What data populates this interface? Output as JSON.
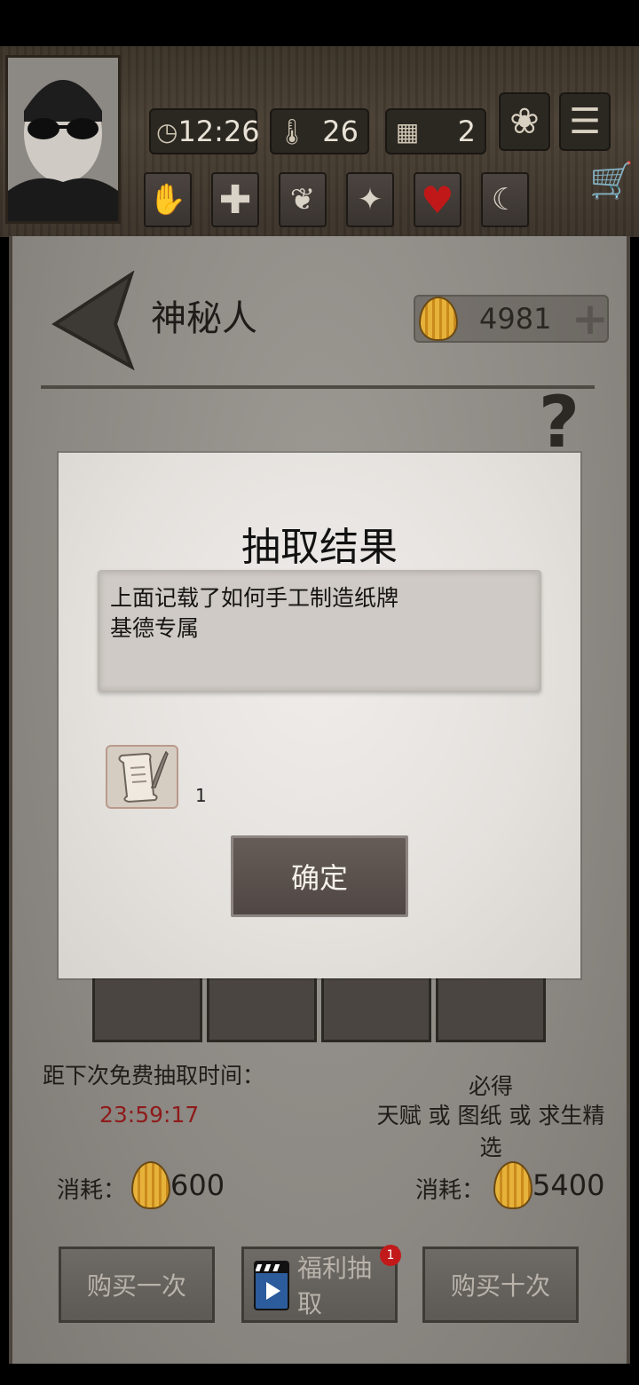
{
  "hud": {
    "time": "12:26",
    "temperature": "26",
    "day": "2"
  },
  "page": {
    "title": "神秘人",
    "currency": "4981"
  },
  "draw": {
    "free_timer_label": "距下次免费抽取时间：",
    "free_timer_value": "23:59:17",
    "guarantee_title": "必得",
    "guarantee_text": "天赋 或 图纸 或 求生精选",
    "cost_label": "消耗：",
    "cost_single": "600",
    "cost_ten": "5400",
    "buy_once": "购买一次",
    "welfare_draw": "福利抽取",
    "welfare_badge": "1",
    "buy_ten": "购买十次"
  },
  "dialog": {
    "title": "抽取结果",
    "lines": [
      "上面记载了如何手工制造纸牌",
      "基德专属"
    ],
    "item_count": "1",
    "confirm": "确定"
  },
  "colors": {
    "timer": "#8e1b1b",
    "badge": "#c21a1a",
    "shell": "#e6b23a"
  }
}
